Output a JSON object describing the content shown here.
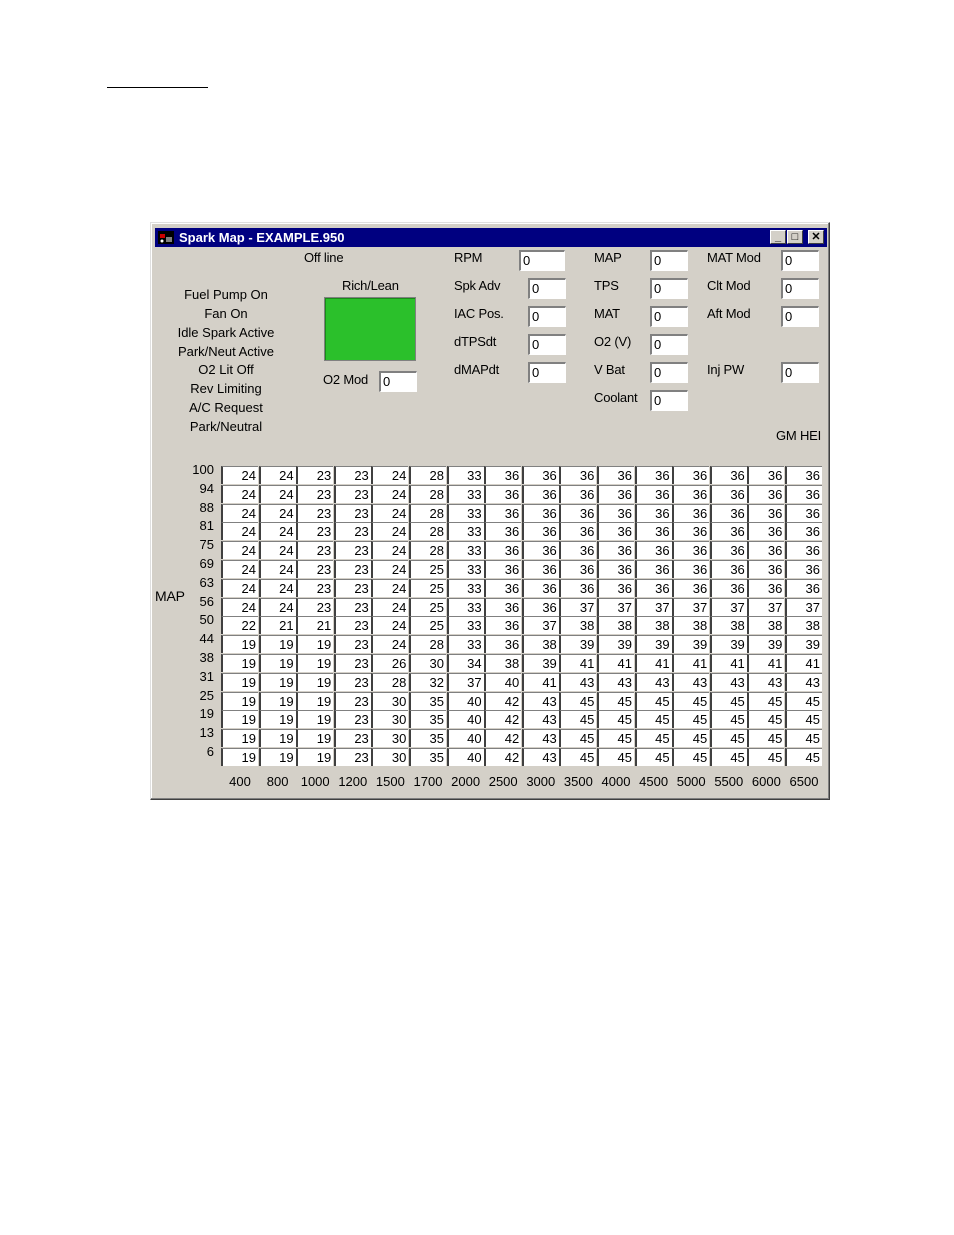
{
  "window": {
    "title": "Spark Map - EXAMPLE.950",
    "minimize_glyph": "_",
    "maximize_glyph": "□",
    "close_glyph": "✕"
  },
  "status": {
    "connection": "Off line",
    "items": [
      "Fuel Pump On",
      "Fan On",
      "Idle Spark Active",
      "Park/Neut Active",
      "O2 Lit Off",
      "Rev Limiting",
      "A/C Request",
      "Park/Neutral"
    ],
    "rich_lean_label": "Rich/Lean",
    "rich_lean_color": "#2bc02b",
    "ecu_type": "GM HEI"
  },
  "fields": {
    "o2mod": {
      "label": "O2 Mod",
      "value": "0"
    },
    "rpm": {
      "label": "RPM",
      "value": "0"
    },
    "spkadv": {
      "label": "Spk Adv",
      "value": "0"
    },
    "iacpos": {
      "label": "IAC Pos.",
      "value": "0"
    },
    "dtpsdt": {
      "label": "dTPSdt",
      "value": "0"
    },
    "dmapdt": {
      "label": "dMAPdt",
      "value": "0"
    },
    "map": {
      "label": "MAP",
      "value": "0"
    },
    "tps": {
      "label": "TPS",
      "value": "0"
    },
    "mat": {
      "label": "MAT",
      "value": "0"
    },
    "o2v": {
      "label": "O2 (V)",
      "value": "0"
    },
    "vbat": {
      "label": "V Bat",
      "value": "0"
    },
    "coolant": {
      "label": "Coolant",
      "value": "0"
    },
    "matmod": {
      "label": "MAT Mod",
      "value": "0"
    },
    "cltmod": {
      "label": "Clt Mod",
      "value": "0"
    },
    "aftmod": {
      "label": "Aft Mod",
      "value": "0"
    },
    "injpw": {
      "label": "Inj PW",
      "value": "0"
    }
  },
  "table": {
    "axis_label": "MAP",
    "map_values": [
      "100",
      "94",
      "88",
      "81",
      "75",
      "69",
      "63",
      "56",
      "50",
      "44",
      "38",
      "31",
      "25",
      "19",
      "13",
      "6"
    ],
    "rpm_values": [
      "400",
      "800",
      "1000",
      "1200",
      "1500",
      "1700",
      "2000",
      "2500",
      "3000",
      "3500",
      "4000",
      "4500",
      "5000",
      "5500",
      "6000",
      "6500"
    ],
    "rows": [
      [
        "24",
        "24",
        "23",
        "23",
        "24",
        "28",
        "33",
        "36",
        "36",
        "36",
        "36",
        "36",
        "36",
        "36",
        "36",
        "36"
      ],
      [
        "24",
        "24",
        "23",
        "23",
        "24",
        "28",
        "33",
        "36",
        "36",
        "36",
        "36",
        "36",
        "36",
        "36",
        "36",
        "36"
      ],
      [
        "24",
        "24",
        "23",
        "23",
        "24",
        "28",
        "33",
        "36",
        "36",
        "36",
        "36",
        "36",
        "36",
        "36",
        "36",
        "36"
      ],
      [
        "24",
        "24",
        "23",
        "23",
        "24",
        "28",
        "33",
        "36",
        "36",
        "36",
        "36",
        "36",
        "36",
        "36",
        "36",
        "36"
      ],
      [
        "24",
        "24",
        "23",
        "23",
        "24",
        "28",
        "33",
        "36",
        "36",
        "36",
        "36",
        "36",
        "36",
        "36",
        "36",
        "36"
      ],
      [
        "24",
        "24",
        "23",
        "23",
        "24",
        "25",
        "33",
        "36",
        "36",
        "36",
        "36",
        "36",
        "36",
        "36",
        "36",
        "36"
      ],
      [
        "24",
        "24",
        "23",
        "23",
        "24",
        "25",
        "33",
        "36",
        "36",
        "36",
        "36",
        "36",
        "36",
        "36",
        "36",
        "36"
      ],
      [
        "24",
        "24",
        "23",
        "23",
        "24",
        "25",
        "33",
        "36",
        "36",
        "37",
        "37",
        "37",
        "37",
        "37",
        "37",
        "37"
      ],
      [
        "22",
        "21",
        "21",
        "23",
        "24",
        "25",
        "33",
        "36",
        "37",
        "38",
        "38",
        "38",
        "38",
        "38",
        "38",
        "38"
      ],
      [
        "19",
        "19",
        "19",
        "23",
        "24",
        "28",
        "33",
        "36",
        "38",
        "39",
        "39",
        "39",
        "39",
        "39",
        "39",
        "39"
      ],
      [
        "19",
        "19",
        "19",
        "23",
        "26",
        "30",
        "34",
        "38",
        "39",
        "41",
        "41",
        "41",
        "41",
        "41",
        "41",
        "41"
      ],
      [
        "19",
        "19",
        "19",
        "23",
        "28",
        "32",
        "37",
        "40",
        "41",
        "43",
        "43",
        "43",
        "43",
        "43",
        "43",
        "43"
      ],
      [
        "19",
        "19",
        "19",
        "23",
        "30",
        "35",
        "40",
        "42",
        "43",
        "45",
        "45",
        "45",
        "45",
        "45",
        "45",
        "45"
      ],
      [
        "19",
        "19",
        "19",
        "23",
        "30",
        "35",
        "40",
        "42",
        "43",
        "45",
        "45",
        "45",
        "45",
        "45",
        "45",
        "45"
      ],
      [
        "19",
        "19",
        "19",
        "23",
        "30",
        "35",
        "40",
        "42",
        "43",
        "45",
        "45",
        "45",
        "45",
        "45",
        "45",
        "45"
      ],
      [
        "19",
        "19",
        "19",
        "23",
        "30",
        "35",
        "40",
        "42",
        "43",
        "45",
        "45",
        "45",
        "45",
        "45",
        "45",
        "45"
      ]
    ]
  }
}
